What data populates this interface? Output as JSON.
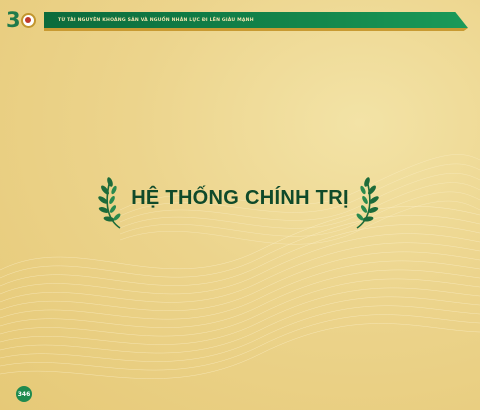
{
  "header": {
    "logo_number": "3",
    "banner_text": "TỪ TÀI NGUYÊN KHOÁNG SẢN VÀ NGUỒN NHÂN LỰC ĐI LÊN GIÀU MẠNH"
  },
  "section": {
    "title": "HỆ THỐNG CHÍNH TRỊ",
    "left_ornament": "laurel-icon",
    "right_ornament": "laurel-icon"
  },
  "footer": {
    "page_number": "346"
  },
  "colors": {
    "background": "#ecd48c",
    "brand_green": "#158a4e",
    "title_green": "#0f4a2a",
    "gold_accent": "#c89a32"
  }
}
